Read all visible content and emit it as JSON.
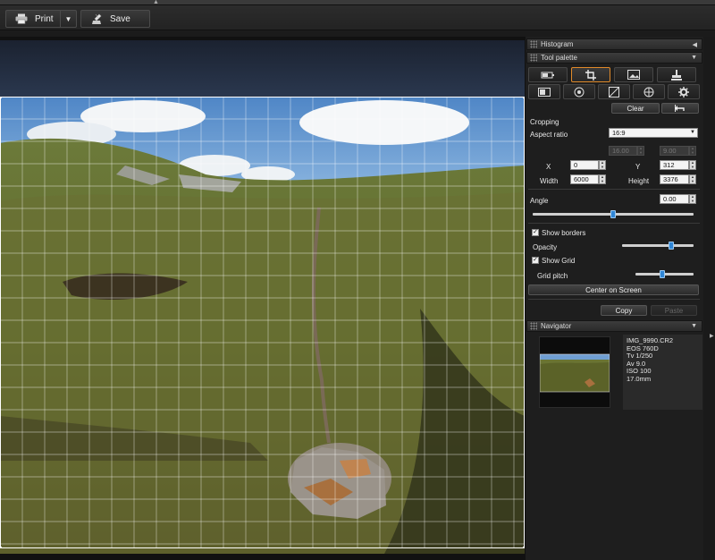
{
  "toolbar": {
    "print_label": "Print",
    "save_label": "Save"
  },
  "panel": {
    "histogram_title": "Histogram",
    "tool_palette_title": "Tool palette",
    "clear_label": "Clear",
    "cropping_title": "Cropping",
    "aspect_ratio_label": "Aspect ratio",
    "aspect_ratio_value": "16:9",
    "ratio_w": "16.00",
    "ratio_h": "9.00",
    "x_label": "X",
    "x_value": "0",
    "y_label": "Y",
    "y_value": "312",
    "width_label": "Width",
    "width_value": "6000",
    "height_label": "Height",
    "height_value": "3376",
    "angle_label": "Angle",
    "angle_value": "0.00",
    "angle_level": 0.5,
    "show_borders_label": "Show borders",
    "show_borders_checked": true,
    "opacity_label": "Opacity",
    "opacity_level": 0.7,
    "show_grid_label": "Show Grid",
    "show_grid_checked": true,
    "grid_pitch_label": "Grid pitch",
    "grid_pitch_level": 0.45,
    "center_label": "Center on Screen",
    "copy_label": "Copy",
    "paste_label": "Paste"
  },
  "navigator": {
    "title": "Navigator",
    "info": [
      "IMG_9990.CR2",
      "EOS 760D",
      "Tv 1/250",
      "Av 9.0",
      "ISO 100",
      "17.0mm"
    ]
  },
  "colors": {
    "accent_selected": "#e08a2a",
    "slider_thumb": "#2f86d6"
  }
}
